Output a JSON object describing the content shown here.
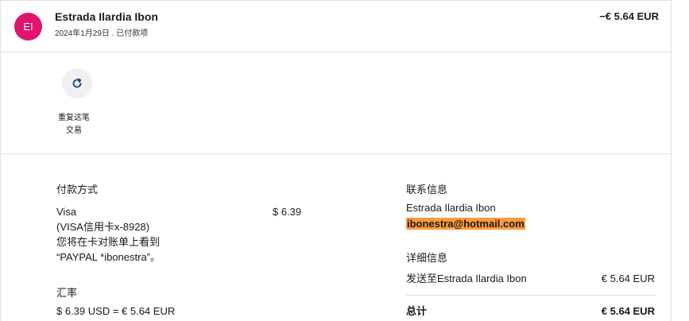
{
  "header": {
    "avatar_initials": "EI",
    "avatar_color": "#e0156d",
    "name": "Estrada Ilardia Ibon",
    "subtitle": "2024年1月29日 . 已付款项",
    "amount": "−€ 5.64 EUR"
  },
  "actions": {
    "repeat_label_line1": "重复这笔",
    "repeat_label_line2": "交易"
  },
  "payment": {
    "heading": "付款方式",
    "method": "Visa",
    "card_detail": "(VISA信用卡x-8928)",
    "statement_note_line1": "您将在卡对账单上看到",
    "statement_note_line2": "“PAYPAL *ibonestra”。",
    "method_amount": "$ 6.39"
  },
  "exchange": {
    "heading": "汇率",
    "rate": "$ 6.39 USD = € 5.64 EUR"
  },
  "contact": {
    "heading": "联系信息",
    "name": "Estrada Ilardia Ibon",
    "email": "ibonestra@hotmail.com"
  },
  "details": {
    "heading": "详细信息",
    "sent_to_label": "发送至Estrada Ilardia Ibon",
    "sent_to_amount": "€ 5.64 EUR",
    "total_label": "总计",
    "total_amount": "€ 5.64 EUR"
  }
}
